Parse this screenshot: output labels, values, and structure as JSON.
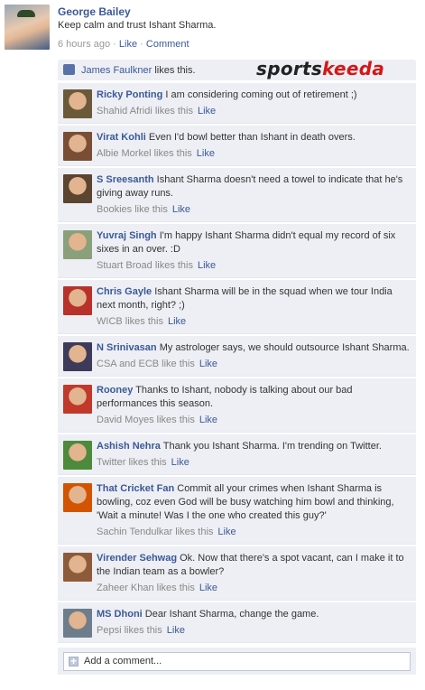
{
  "post": {
    "author": "George Bailey",
    "text": "Keep calm and trust Ishant Sharma.",
    "time": "6 hours ago",
    "like_link": "Like",
    "comment_link": "Comment",
    "sep": "·"
  },
  "likes": {
    "user": "James Faulkner",
    "suffix": " likes this."
  },
  "logo": {
    "part1": "sports",
    "part2": "keeda"
  },
  "comments": [
    {
      "name": "Ricky Ponting",
      "text": "I am considering coming out of retirement ;)",
      "likes": "Shahid Afridi likes this",
      "like": "Like",
      "avatar": "#6b5a3a"
    },
    {
      "name": "Virat Kohli",
      "text": "Even I'd bowl better than Ishant in death overs.",
      "likes": "Albie Morkel likes this",
      "like": "Like",
      "avatar": "#7a4e35"
    },
    {
      "name": "S Sreesanth",
      "text": "Ishant Sharma doesn't need a towel to indicate that he's giving away runs.",
      "likes": "Bookies like this",
      "like": "Like",
      "avatar": "#5b4430"
    },
    {
      "name": "Yuvraj Singh",
      "text": "I'm happy Ishant Sharma didn't equal my record of six sixes in an over. :D",
      "likes": "Stuart Broad likes this",
      "like": "Like",
      "avatar": "#8aa07a"
    },
    {
      "name": "Chris Gayle",
      "text": "Ishant Sharma will be in the squad when we tour India next month, right? ;)",
      "likes": "WICB likes this",
      "like": "Like",
      "avatar": "#b8322b"
    },
    {
      "name": "N Srinivasan",
      "text": "My astrologer says, we should outsource Ishant Sharma.",
      "likes": "CSA and ECB like this",
      "like": "Like",
      "avatar": "#3e3a5a"
    },
    {
      "name": "Rooney",
      "text": "Thanks to Ishant, nobody is talking about our bad performances this season.",
      "likes": "David Moyes likes this",
      "like": "Like",
      "avatar": "#c0392b"
    },
    {
      "name": "Ashish Nehra",
      "text": "Thank you Ishant Sharma. I'm trending on Twitter.",
      "likes": "Twitter likes this",
      "like": "Like",
      "avatar": "#4d8a3c"
    },
    {
      "name": "That Cricket Fan",
      "text": "Commit all your crimes when Ishant Sharma is bowling, coz even God will be busy watching him bowl and thinking, 'Wait a minute! Was I the one who created this guy?'",
      "likes": "Sachin Tendulkar likes this",
      "like": "Like",
      "avatar": "#d35400"
    },
    {
      "name": "Virender Sehwag",
      "text": "Ok. Now that there's a spot vacant, can I make it to the Indian team as a bowler?",
      "likes": "Zaheer Khan likes this",
      "like": "Like",
      "avatar": "#8e5b3a"
    },
    {
      "name": "MS Dhoni",
      "text": "Dear Ishant Sharma, change the game.",
      "likes": "Pepsi likes this",
      "like": "Like",
      "avatar": "#6d7d8c"
    }
  ],
  "add_comment": {
    "placeholder": "Add a comment..."
  }
}
